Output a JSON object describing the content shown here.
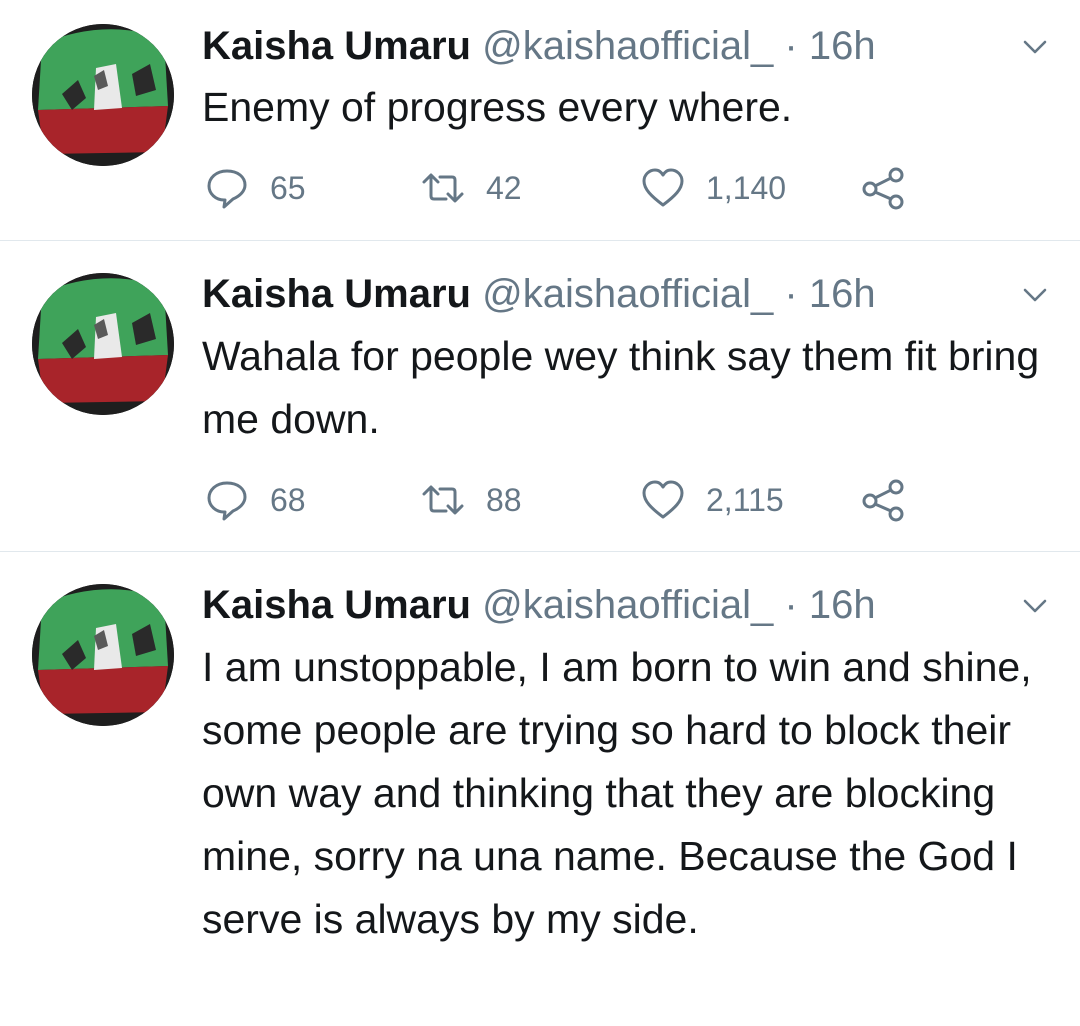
{
  "colors": {
    "text": "#14171a",
    "muted": "#657786",
    "divider": "#e1e8ed",
    "avatar_green": "#3fa35a",
    "avatar_white": "#e9e9e9",
    "avatar_red": "#a8242a"
  },
  "tweets": [
    {
      "author_name": "Kaisha Umaru",
      "handle": "@kaishaofficial_",
      "separator": "·",
      "time": "16h",
      "text": "Enemy of progress every where.",
      "replies": "65",
      "retweets": "42",
      "likes": "1,140"
    },
    {
      "author_name": "Kaisha Umaru",
      "handle": "@kaishaofficial_",
      "separator": "·",
      "time": "16h",
      "text": "Wahala for people wey think say them fit bring me down.",
      "replies": "68",
      "retweets": "88",
      "likes": "2,115"
    },
    {
      "author_name": "Kaisha Umaru",
      "handle": "@kaishaofficial_",
      "separator": "·",
      "time": "16h",
      "text": "I am unstoppable, I am born to win and shine, some people are trying so hard to block their own way and thinking that they are blocking mine, sorry na una name. Because the God I serve is always by my side."
    }
  ]
}
